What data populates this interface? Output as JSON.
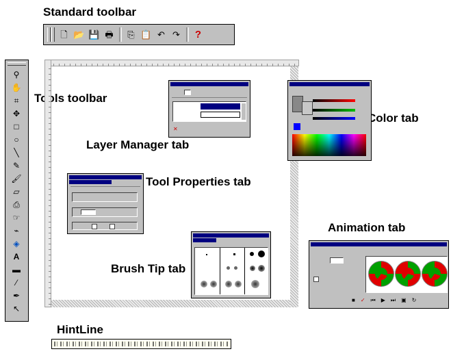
{
  "labels": {
    "standard_toolbar": "Standard toolbar",
    "tools_toolbar": "Tools toolbar",
    "layer_manager_tab": "Layer Manager tab",
    "color_tab": "Color tab",
    "tool_properties_tab": "Tool Properties tab",
    "animation_tab": "Animation tab",
    "brush_tip_tab": "Brush Tip tab",
    "hintline": "HintLine"
  },
  "standard_toolbar_buttons": [
    {
      "name": "new",
      "icon": "new-document-icon",
      "glyph": "🗋"
    },
    {
      "name": "open",
      "icon": "open-folder-icon",
      "glyph": "📂"
    },
    {
      "name": "save",
      "icon": "save-disk-icon",
      "glyph": "💾"
    },
    {
      "name": "print",
      "icon": "printer-icon",
      "glyph": "🖶"
    },
    {
      "name": "copy",
      "icon": "copy-icon",
      "glyph": "⎘"
    },
    {
      "name": "paste",
      "icon": "paste-icon",
      "glyph": "📋"
    },
    {
      "name": "undo",
      "icon": "undo-icon",
      "glyph": "↶"
    },
    {
      "name": "redo",
      "icon": "redo-icon",
      "glyph": "↷"
    },
    {
      "name": "help",
      "icon": "help-icon",
      "glyph": "?"
    }
  ],
  "tools": [
    {
      "icon": "zoom-icon",
      "glyph": "⚲"
    },
    {
      "icon": "hand-icon",
      "glyph": "✋"
    },
    {
      "icon": "crop-icon",
      "glyph": "⌗"
    },
    {
      "icon": "move-icon",
      "glyph": "✥"
    },
    {
      "icon": "rectangle-select-icon",
      "glyph": "□"
    },
    {
      "icon": "ellipse-select-icon",
      "glyph": "○"
    },
    {
      "icon": "line-icon",
      "glyph": "╲"
    },
    {
      "icon": "pencil-icon",
      "glyph": "✎"
    },
    {
      "icon": "brush-icon",
      "glyph": "🖌"
    },
    {
      "icon": "eraser-icon",
      "glyph": "▱"
    },
    {
      "icon": "clone-icon",
      "glyph": "⎙"
    },
    {
      "icon": "retouch-icon",
      "glyph": "☞"
    },
    {
      "icon": "eyedropper-icon",
      "glyph": "⌁"
    },
    {
      "icon": "fill-icon",
      "glyph": "◈"
    },
    {
      "icon": "text-icon",
      "glyph": "A"
    },
    {
      "icon": "shape-icon",
      "glyph": "▬"
    },
    {
      "icon": "line-shape-icon",
      "glyph": "⁄"
    },
    {
      "icon": "airbrush-icon",
      "glyph": "✒"
    },
    {
      "icon": "select-arrow-icon",
      "glyph": "↖"
    }
  ],
  "colors": {
    "title_bar": "#000080",
    "face": "#c0c0c0",
    "help_red": "#cc0000",
    "spiral_green": "#00a000",
    "spiral_red": "#e00000",
    "swatch_blue": "#0000ff"
  }
}
